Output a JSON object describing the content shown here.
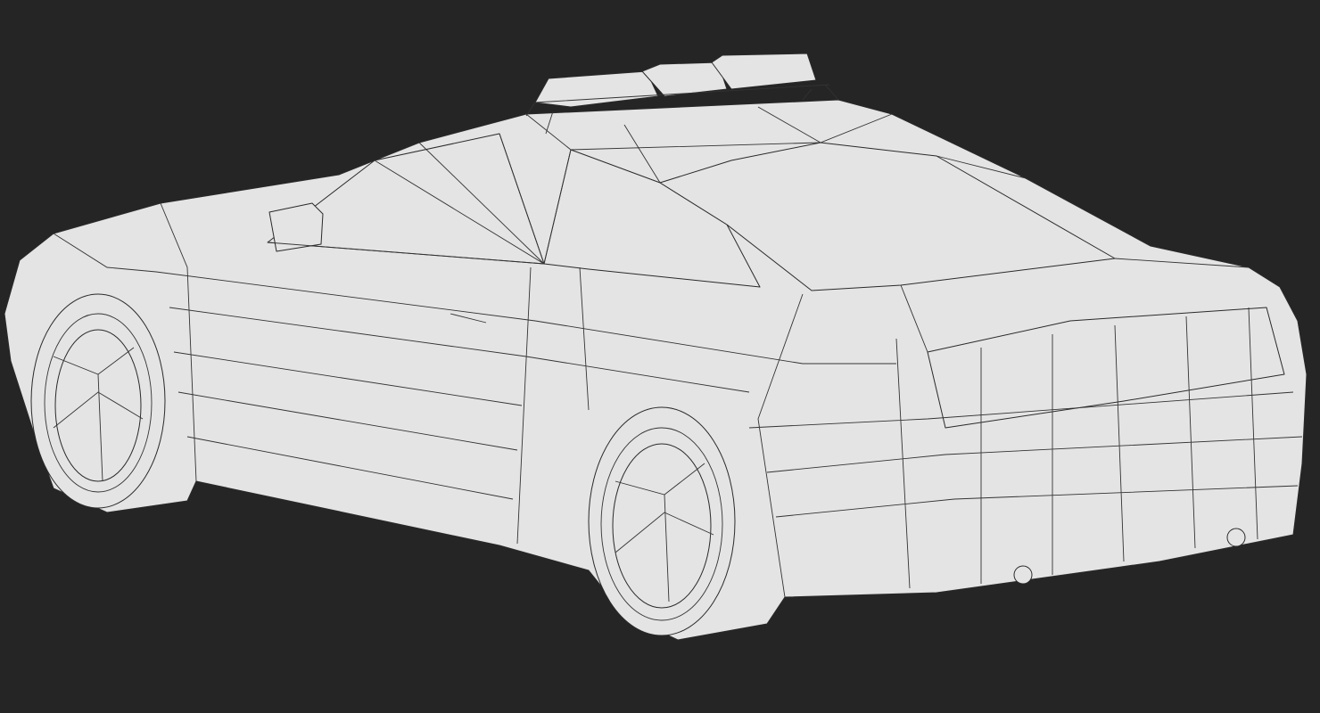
{
  "scene": {
    "subject": "police-car-wireframe",
    "colors": {
      "background": "#252525",
      "surface": "#e4e4e4",
      "wire": "#2a2a2a"
    }
  }
}
